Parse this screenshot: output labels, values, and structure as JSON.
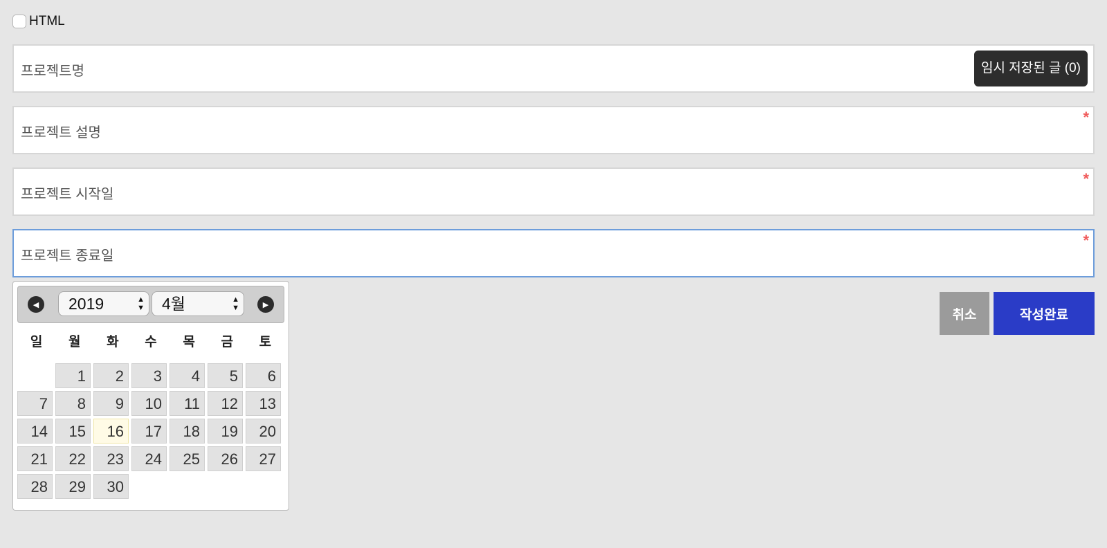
{
  "html_toggle": {
    "label": "HTML"
  },
  "fields": {
    "project_name": {
      "placeholder": "프로젝트명"
    },
    "project_description": {
      "placeholder": "프로젝트 설명"
    },
    "project_start_date": {
      "placeholder": "프로젝트 시작일"
    },
    "project_end_date": {
      "placeholder": "프로젝트 종료일"
    },
    "required_mark": "*"
  },
  "temp_saved": {
    "label": "임시 저장된 글 (0)"
  },
  "calendar": {
    "year": "2019",
    "month": "4월",
    "weekdays": [
      "일",
      "월",
      "화",
      "수",
      "목",
      "금",
      "토"
    ],
    "first_day_offset": 1,
    "days": [
      "1",
      "2",
      "3",
      "4",
      "5",
      "6",
      "7",
      "8",
      "9",
      "10",
      "11",
      "12",
      "13",
      "14",
      "15",
      "16",
      "17",
      "18",
      "19",
      "20",
      "21",
      "22",
      "23",
      "24",
      "25",
      "26",
      "27",
      "28",
      "29",
      "30"
    ],
    "today": "16"
  },
  "actions": {
    "cancel": "취소",
    "submit": "작성완료"
  },
  "colors": {
    "submit_bg": "#2a3cc7",
    "cancel_bg": "#9b9b9b",
    "required": "#f05a5a",
    "active_border": "#6d9ddb"
  }
}
